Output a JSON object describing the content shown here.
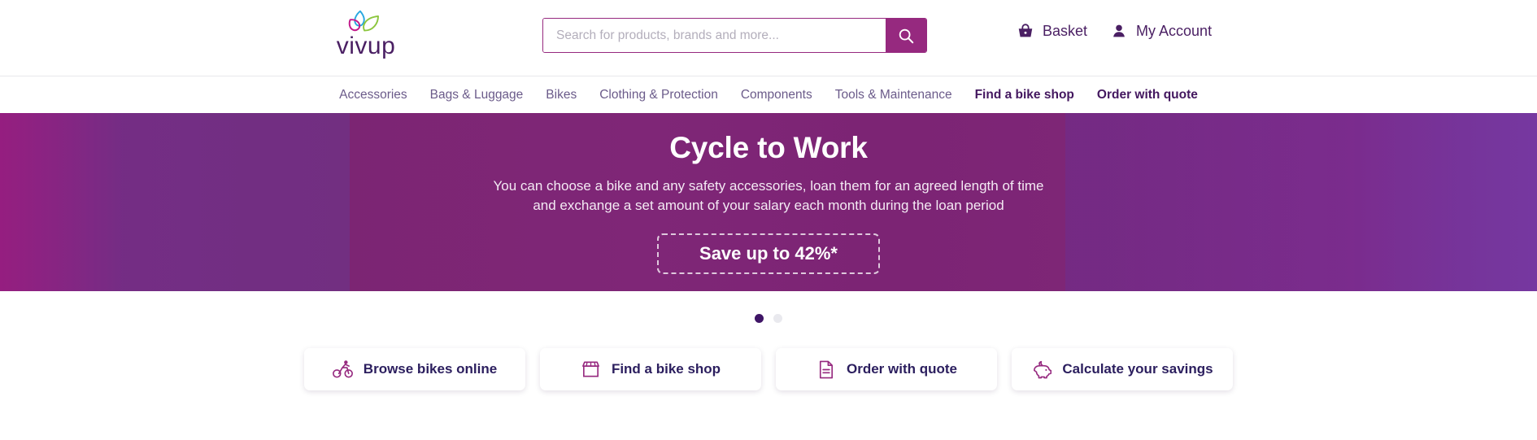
{
  "header": {
    "logo": {
      "name": "vivup-logo",
      "wordmark": "vivup",
      "colors": {
        "blue": "#29a8e0",
        "magenta": "#c2198a",
        "green": "#8cc63e",
        "word": "#4a1f63"
      }
    },
    "search": {
      "placeholder": "Search for products, brands and more...",
      "value": "",
      "button_icon": "search-icon",
      "accent": "#96297f"
    },
    "links": [
      {
        "icon": "basket-icon",
        "label": "Basket"
      },
      {
        "icon": "person-icon",
        "label": "My Account"
      }
    ]
  },
  "nav": {
    "items": [
      {
        "label": "Accessories",
        "strong": false
      },
      {
        "label": "Bags & Luggage",
        "strong": false
      },
      {
        "label": "Bikes",
        "strong": false
      },
      {
        "label": "Clothing & Protection",
        "strong": false
      },
      {
        "label": "Components",
        "strong": false
      },
      {
        "label": "Tools & Maintenance",
        "strong": false
      },
      {
        "label": "Find a bike shop",
        "strong": true
      },
      {
        "label": "Order with quote",
        "strong": true
      }
    ]
  },
  "hero": {
    "title": "Cycle to Work",
    "subtitle": "You can choose a bike and any safety accessories, loan them for an agreed length of time and exchange a set amount of your salary each month during the loan period",
    "cta_label": "Save up to 42%*",
    "background": "#7d2373"
  },
  "carousel": {
    "slides": 2,
    "active_index": 0,
    "active_color": "#3f1566",
    "inactive_color": "#e9e9ee"
  },
  "actions": [
    {
      "icon": "cyclist-icon",
      "label": "Browse bikes online"
    },
    {
      "icon": "storefront-icon",
      "label": "Find a bike shop"
    },
    {
      "icon": "document-icon",
      "label": "Order with quote"
    },
    {
      "icon": "piggy-bank-icon",
      "label": "Calculate your savings"
    }
  ]
}
